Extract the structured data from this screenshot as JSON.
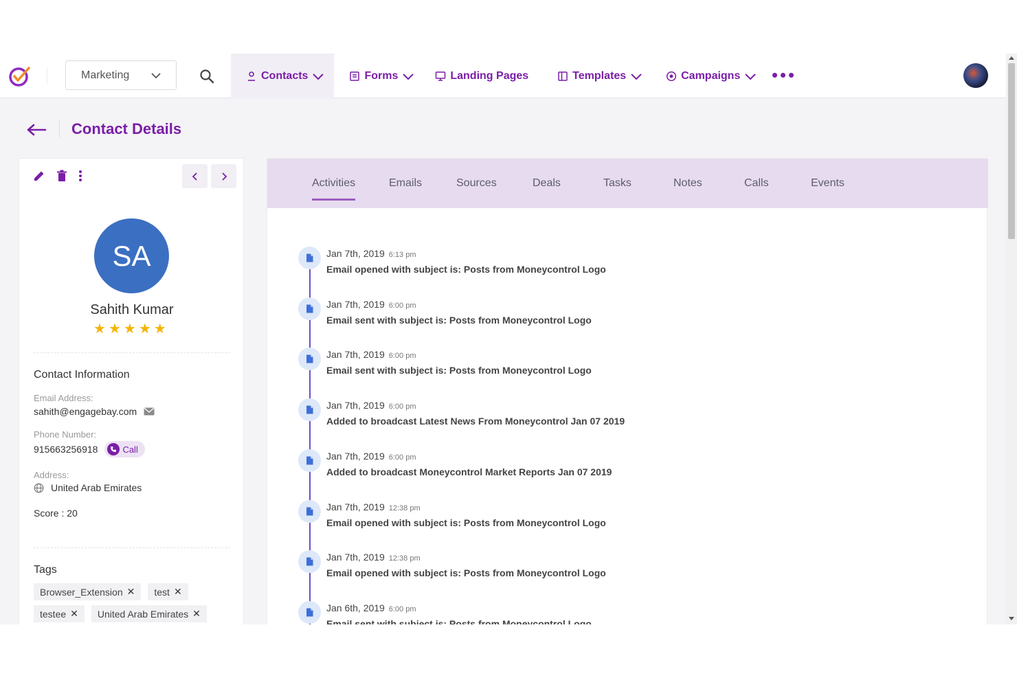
{
  "nav": {
    "workspace": "Marketing",
    "items": [
      {
        "label": "Contacts",
        "icon": "user-icon",
        "active": true,
        "dropdown": true
      },
      {
        "label": "Forms",
        "icon": "form-icon",
        "active": false,
        "dropdown": true
      },
      {
        "label": "Landing Pages",
        "icon": "monitor-icon",
        "active": false,
        "dropdown": false
      },
      {
        "label": "Templates",
        "icon": "template-icon",
        "active": false,
        "dropdown": true
      },
      {
        "label": "Campaigns",
        "icon": "campaign-icon",
        "active": false,
        "dropdown": true
      }
    ]
  },
  "page": {
    "title": "Contact Details"
  },
  "contact": {
    "initials": "SA",
    "name": "Sahith Kumar",
    "rating": 5,
    "info_title": "Contact Information",
    "email_label": "Email Address:",
    "email": "sahith@engagebay.com",
    "phone_label": "Phone Number:",
    "phone": "915663256918",
    "call_label": "Call",
    "address_label": "Address:",
    "address": "United Arab Emirates",
    "score": "Score : 20",
    "tags_title": "Tags",
    "tags": [
      "Browser_Extension",
      "test",
      "testee",
      "United Arab Emirates"
    ]
  },
  "tabs": [
    "Activities",
    "Emails",
    "Sources",
    "Deals",
    "Tasks",
    "Notes",
    "Calls",
    "Events"
  ],
  "activities": [
    {
      "date": "Jan 7th, 2019",
      "time": "6:13 pm",
      "text": "Email opened with subject is: Posts from Moneycontrol Logo"
    },
    {
      "date": "Jan 7th, 2019",
      "time": "6:00 pm",
      "text": "Email sent with subject is: Posts from Moneycontrol Logo"
    },
    {
      "date": "Jan 7th, 2019",
      "time": "6:00 pm",
      "text": "Email sent with subject is: Posts from Moneycontrol Logo"
    },
    {
      "date": "Jan 7th, 2019",
      "time": "6:00 pm",
      "text": "Added to broadcast Latest News From Moneycontrol Jan 07 2019"
    },
    {
      "date": "Jan 7th, 2019",
      "time": "6:00 pm",
      "text": "Added to broadcast Moneycontrol Market Reports Jan 07 2019"
    },
    {
      "date": "Jan 7th, 2019",
      "time": "12:38 pm",
      "text": "Email opened with subject is: Posts from Moneycontrol Logo"
    },
    {
      "date": "Jan 7th, 2019",
      "time": "12:38 pm",
      "text": "Email opened with subject is: Posts from Moneycontrol Logo"
    },
    {
      "date": "Jan 6th, 2019",
      "time": "6:00 pm",
      "text": "Email sent with subject is: Posts from Moneycontrol Logo"
    }
  ],
  "colors": {
    "brand": "#7a1ea8",
    "tab_bar": "#e7dbf0",
    "avatar": "#3b6fc2",
    "star": "#f4b400"
  }
}
